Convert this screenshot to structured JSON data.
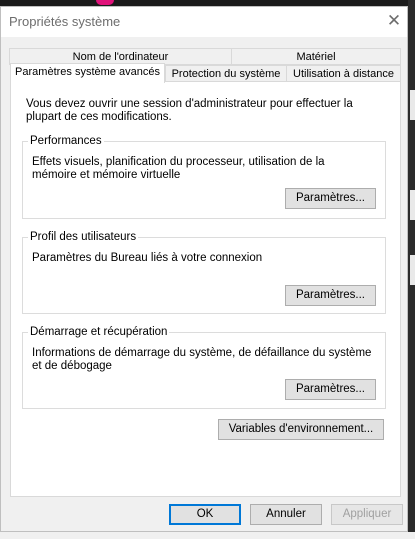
{
  "window": {
    "title": "Propriétés système",
    "close_glyph": "✕"
  },
  "tabs": {
    "row1": [
      "Nom de l'ordinateur",
      "Matériel"
    ],
    "row2": [
      "Paramètres système avancés",
      "Protection du système",
      "Utilisation à distance"
    ],
    "active": "Paramètres système avancés"
  },
  "panel": {
    "intro": "Vous devez ouvrir une session d'administrateur pour effectuer la plupart de ces modifications.",
    "performance": {
      "legend": "Performances",
      "description": "Effets visuels, planification du processeur, utilisation de la mémoire et mémoire virtuelle",
      "button": "Paramètres..."
    },
    "user_profiles": {
      "legend": "Profil des utilisateurs",
      "description": "Paramètres du Bureau liés à votre connexion",
      "button": "Paramètres..."
    },
    "startup_recovery": {
      "legend": "Démarrage et récupération",
      "description": "Informations de démarrage du système, de défaillance du système et de débogage",
      "button": "Paramètres..."
    },
    "env_button": "Variables d'environnement..."
  },
  "footer": {
    "ok": "OK",
    "cancel": "Annuler",
    "apply": "Appliquer"
  },
  "icons": {
    "close": "close-icon"
  }
}
